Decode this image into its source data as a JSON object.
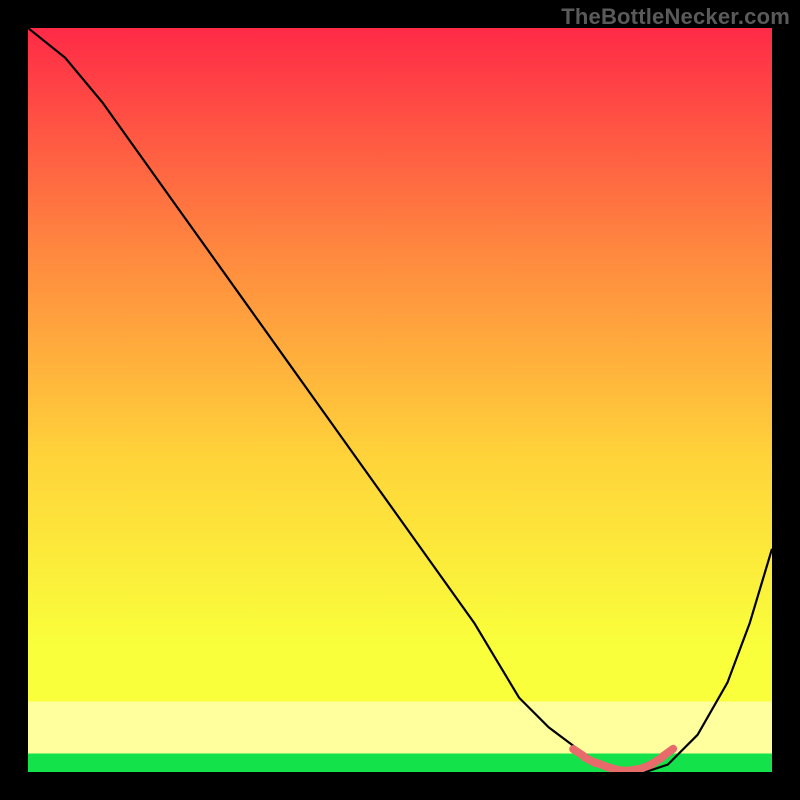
{
  "attribution": "TheBottleNecker.com",
  "colors": {
    "frame": "#000000",
    "gradient_top": "#ff2a47",
    "gradient_mid_upper": "#ff883f",
    "gradient_mid": "#ffd43a",
    "gradient_lower": "#f9ff3b",
    "gradient_bottom_band": "#ffff9e",
    "gradient_green": "#14e24a",
    "curve": "#000000",
    "marker": "#e86a6a"
  },
  "chart_data": {
    "type": "line",
    "title": "",
    "xlabel": "",
    "ylabel": "",
    "xlim": [
      0,
      100
    ],
    "ylim": [
      0,
      100
    ],
    "series": [
      {
        "name": "bottleneck-curve",
        "x": [
          0,
          5,
          10,
          15,
          20,
          25,
          30,
          35,
          40,
          45,
          50,
          55,
          60,
          63,
          66,
          70,
          74,
          77,
          80,
          83,
          86,
          90,
          94,
          97,
          100
        ],
        "y": [
          100,
          96,
          90,
          83,
          76,
          69,
          62,
          55,
          48,
          41,
          34,
          27,
          20,
          15,
          10,
          6,
          3,
          1,
          0,
          0,
          1,
          5,
          12,
          20,
          30
        ]
      }
    ],
    "markers": {
      "name": "optimal-range",
      "x": [
        74,
        75.5,
        77,
        78.5,
        80,
        81.5,
        83,
        84.5,
        86
      ],
      "y": [
        2.6,
        1.6,
        1.0,
        0.5,
        0.2,
        0.3,
        0.7,
        1.5,
        2.6
      ]
    }
  }
}
